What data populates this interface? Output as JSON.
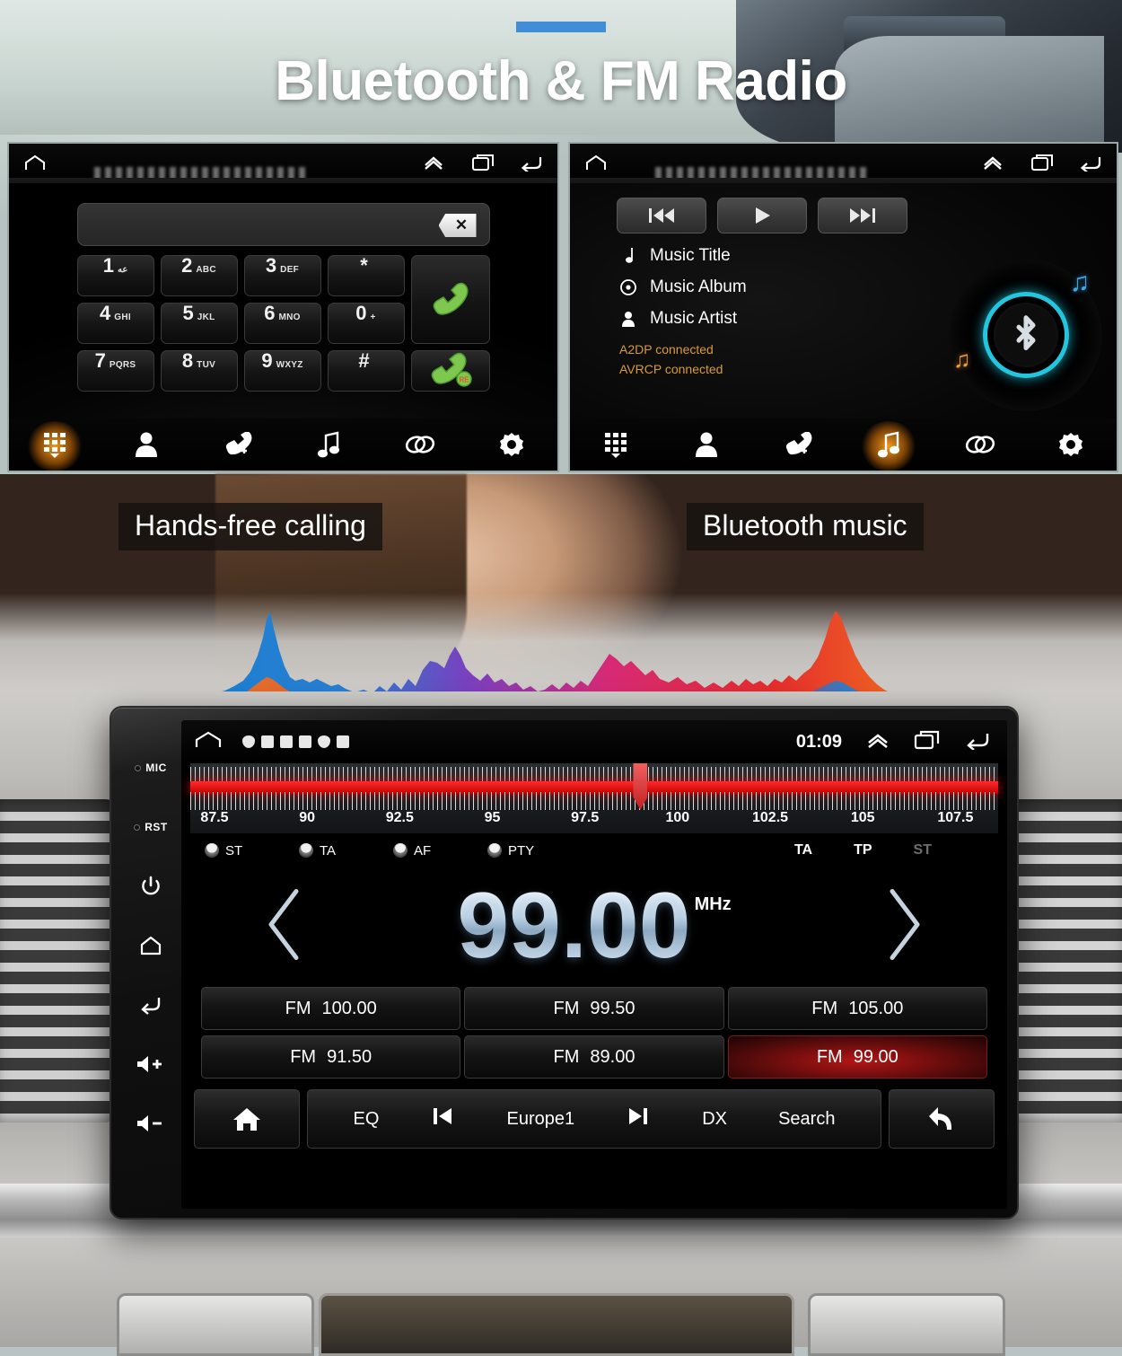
{
  "page": {
    "title": "Bluetooth & FM Radio",
    "accent_color": "#3f8ed6"
  },
  "captions": {
    "left": "Hands-free calling",
    "right": "Bluetooth music"
  },
  "bt_call_screen": {
    "statusbar": {
      "home_icon": "home-icon",
      "app_title_blurred": "",
      "expand_icon": "chevron-up-icon",
      "recents_icon": "recents-icon",
      "back_icon": "back-icon"
    },
    "number_input": {
      "value": "",
      "placeholder": ""
    },
    "backspace_label": "✕",
    "keys": [
      {
        "digit": "1",
        "sub": "عه"
      },
      {
        "digit": "2",
        "sub": "ABC"
      },
      {
        "digit": "3",
        "sub": "DEF"
      },
      {
        "digit": "*",
        "sub": ""
      },
      {
        "digit": "4",
        "sub": "GHI"
      },
      {
        "digit": "5",
        "sub": "JKL"
      },
      {
        "digit": "6",
        "sub": "MNO"
      },
      {
        "digit": "0",
        "sub": "+"
      },
      {
        "digit": "7",
        "sub": "PQRS"
      },
      {
        "digit": "8",
        "sub": "TUV"
      },
      {
        "digit": "9",
        "sub": "WXYZ"
      },
      {
        "digit": "#",
        "sub": ""
      }
    ],
    "answer_button": "phone-answer-icon",
    "redial_button": "phone-redial-icon",
    "navbar": [
      {
        "name": "keypad",
        "icon": "keypad-icon",
        "active": true
      },
      {
        "name": "contacts",
        "icon": "contact-icon",
        "active": false
      },
      {
        "name": "calllog",
        "icon": "call-log-icon",
        "active": false
      },
      {
        "name": "music",
        "icon": "music-note-icon",
        "active": false
      },
      {
        "name": "pair",
        "icon": "link-icon",
        "active": false
      },
      {
        "name": "settings",
        "icon": "gear-icon",
        "active": false
      }
    ]
  },
  "bt_music_screen": {
    "statusbar": {
      "home_icon": "home-icon",
      "app_title_blurred": "",
      "expand_icon": "chevron-up-icon",
      "recents_icon": "recents-icon",
      "back_icon": "back-icon"
    },
    "transport": [
      {
        "name": "previous",
        "icon": "skip-previous-icon"
      },
      {
        "name": "play",
        "icon": "play-icon"
      },
      {
        "name": "next",
        "icon": "skip-next-icon"
      }
    ],
    "metadata": [
      {
        "icon": "music-note-icon",
        "label": "Music Title"
      },
      {
        "icon": "disc-icon",
        "label": "Music Album"
      },
      {
        "icon": "person-icon",
        "label": "Music Artist"
      }
    ],
    "connection": {
      "a2dp": "A2DP connected",
      "avrcp": "AVRCP connected",
      "color": "#d99b33"
    },
    "artwork": {
      "name": "bluetooth-vinyl-artwork",
      "ring_color": "#22c6de",
      "note_blue": "♫",
      "note_orange": "♫"
    },
    "navbar": [
      {
        "name": "keypad",
        "icon": "keypad-icon",
        "active": false
      },
      {
        "name": "contacts",
        "icon": "contact-icon",
        "active": false
      },
      {
        "name": "calllog",
        "icon": "call-log-icon",
        "active": false
      },
      {
        "name": "music",
        "icon": "music-note-icon",
        "active": true
      },
      {
        "name": "pair",
        "icon": "link-icon",
        "active": false
      },
      {
        "name": "settings",
        "icon": "gear-icon",
        "active": false
      }
    ]
  },
  "head_unit": {
    "side_buttons": [
      {
        "name": "mic",
        "label": "MIC",
        "type": "hole"
      },
      {
        "name": "reset",
        "label": "RST",
        "type": "hole"
      },
      {
        "name": "power",
        "label": "",
        "type": "icon",
        "icon": "power-icon"
      },
      {
        "name": "home",
        "label": "",
        "type": "icon",
        "icon": "home-icon"
      },
      {
        "name": "back",
        "label": "",
        "type": "icon",
        "icon": "back-icon"
      },
      {
        "name": "volume-up",
        "label": "+",
        "type": "icon",
        "icon": "volume-up-icon"
      },
      {
        "name": "volume-down",
        "label": "−",
        "type": "icon",
        "icon": "volume-down-icon"
      }
    ],
    "fm_screen": {
      "statusbar": {
        "home_icon": "home-icon",
        "clock": "01:09",
        "expand_icon": "chevron-up-icon",
        "recents_icon": "recents-icon",
        "back_icon": "back-icon"
      },
      "dial": {
        "scale_labels": [
          "87.5",
          "90",
          "92.5",
          "95",
          "97.5",
          "100",
          "102.5",
          "105",
          "107.5"
        ],
        "range_min": 87.5,
        "range_max": 108.0,
        "pointer_frequency": "99.00"
      },
      "rds_toggles": [
        {
          "label": "ST",
          "on": false
        },
        {
          "label": "TA",
          "on": false
        },
        {
          "label": "AF",
          "on": false
        },
        {
          "label": "PTY",
          "on": false
        }
      ],
      "rds_flags": [
        {
          "label": "TA",
          "active": true
        },
        {
          "label": "TP",
          "active": true
        },
        {
          "label": "ST",
          "active": false
        }
      ],
      "frequency": {
        "value": "99.00",
        "unit": "MHz"
      },
      "prev_icon": "chevron-left-icon",
      "next_icon": "chevron-right-icon",
      "presets": [
        {
          "band": "FM",
          "freq": "100.00",
          "active": false
        },
        {
          "band": "FM",
          "freq": "99.50",
          "active": false
        },
        {
          "band": "FM",
          "freq": "105.00",
          "active": false
        },
        {
          "band": "FM",
          "freq": "91.50",
          "active": false
        },
        {
          "band": "FM",
          "freq": "89.00",
          "active": false
        },
        {
          "band": "FM",
          "freq": "99.00",
          "active": true
        }
      ],
      "toolbar": {
        "home_icon": "home-icon",
        "back_icon": "back-arrow-icon",
        "items": [
          {
            "name": "eq",
            "label": "EQ",
            "icon": ""
          },
          {
            "name": "prev",
            "label": "",
            "icon": "skip-previous-icon"
          },
          {
            "name": "band",
            "label": "Europe1",
            "icon": ""
          },
          {
            "name": "next",
            "label": "",
            "icon": "skip-next-icon"
          },
          {
            "name": "distance",
            "label": "DX",
            "icon": ""
          },
          {
            "name": "search",
            "label": "Search",
            "icon": ""
          }
        ]
      }
    }
  },
  "waveform": {
    "name": "audio-spectrum-visualizer",
    "colors": [
      "#1a7fd4",
      "#f07820",
      "#8a3fbf",
      "#e0266b",
      "#e62323"
    ]
  }
}
